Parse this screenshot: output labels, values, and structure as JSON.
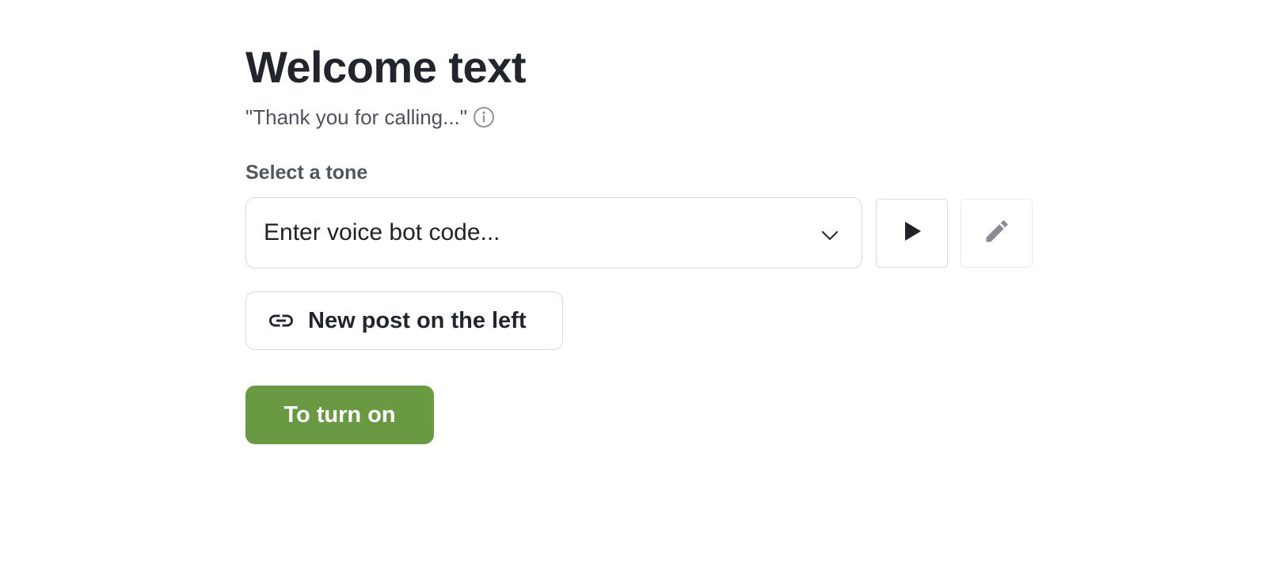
{
  "header": {
    "title": "Welcome text",
    "subtitle": "\"Thank you for calling...\""
  },
  "tone": {
    "label": "Select a tone",
    "select_value": "Enter voice bot code..."
  },
  "link_button": {
    "label": "New post on the left"
  },
  "primary_button": {
    "label": "To turn on"
  },
  "icons": {
    "info": "info-icon",
    "chevron": "chevron-down-icon",
    "play": "play-icon",
    "edit": "pencil-icon",
    "link": "link-icon"
  },
  "colors": {
    "primary": "#6a9944",
    "heading": "#22252b",
    "border": "#d7dadf"
  }
}
